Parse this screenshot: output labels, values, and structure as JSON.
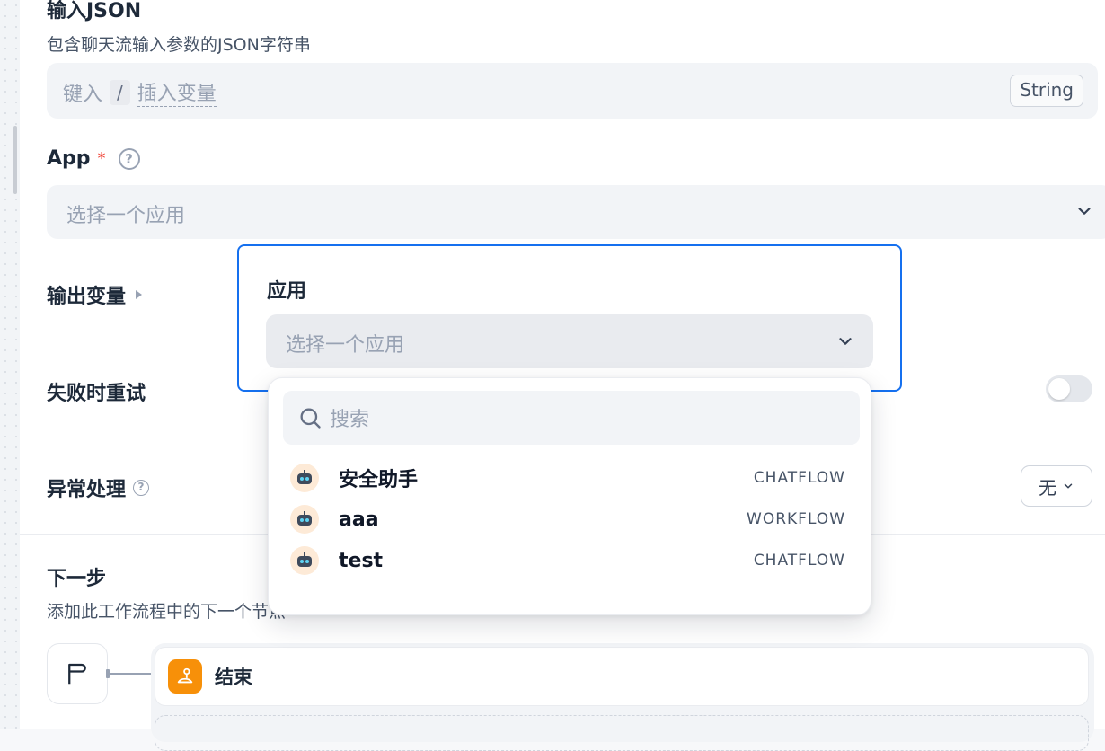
{
  "input_json": {
    "title": "输入JSON",
    "description": "包含聊天流输入参数的JSON字符串",
    "placeholder_before": "键入",
    "slash": "/",
    "placeholder_after": "插入变量",
    "type_tag": "String"
  },
  "app": {
    "label": "App",
    "required_mark": "*",
    "help": "?",
    "placeholder": "选择一个应用"
  },
  "output_vars": {
    "label": "输出变量"
  },
  "retry": {
    "label": "失败时重试"
  },
  "exception": {
    "label": "异常处理",
    "help": "?",
    "value": "无"
  },
  "next_step": {
    "title": "下一步",
    "description": "添加此工作流程中的下一个节点",
    "end_node_label": "结束"
  },
  "app_popup": {
    "title": "应用",
    "placeholder": "选择一个应用",
    "search_placeholder": "搜索",
    "options": [
      {
        "name": "安全助手",
        "type": "CHATFLOW"
      },
      {
        "name": "aaa",
        "type": "WORKFLOW"
      },
      {
        "name": "test",
        "type": "CHATFLOW"
      }
    ]
  },
  "colors": {
    "accent": "#1570ef",
    "required": "#f04438",
    "end_icon": "#f79009"
  }
}
